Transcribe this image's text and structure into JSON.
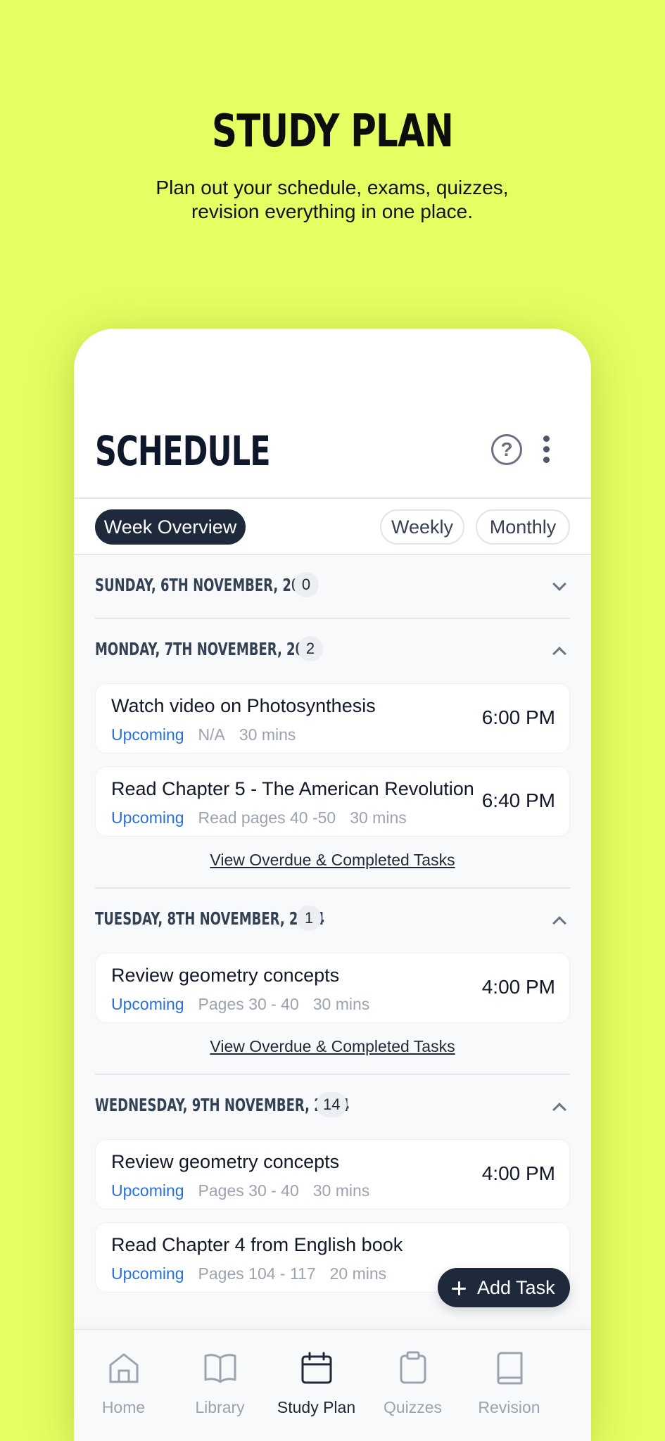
{
  "promo": {
    "title": "STUDY PLAN",
    "subtitle": "Plan out your schedule, exams, quizzes, revision everything in one place."
  },
  "header": {
    "title": "SCHEDULE",
    "help_icon": "question-circle-icon",
    "more_icon": "vertical-dots-icon"
  },
  "tabs": [
    {
      "label": "Week Overview",
      "active": true
    },
    {
      "label": "Weekly",
      "active": false
    },
    {
      "label": "Monthly",
      "active": false
    }
  ],
  "days": [
    {
      "title": "SUNDAY, 6TH NOVEMBER, 2024",
      "count": "0",
      "expanded": false,
      "tasks": []
    },
    {
      "title": "MONDAY, 7TH NOVEMBER, 2024",
      "count": "2",
      "expanded": true,
      "tasks": [
        {
          "title": "Watch video on Photosynthesis",
          "status": "Upcoming",
          "detail": "N/A",
          "duration": "30 mins",
          "time": "6:00 PM"
        },
        {
          "title": "Read Chapter 5 - The American Revolution",
          "status": "Upcoming",
          "detail": "Read pages 40 -50",
          "duration": "30 mins",
          "time": "6:40 PM"
        }
      ],
      "link": "View Overdue & Completed Tasks"
    },
    {
      "title": "TUESDAY, 8TH NOVEMBER, 2024",
      "count": "1",
      "expanded": true,
      "tasks": [
        {
          "title": "Review geometry concepts",
          "status": "Upcoming",
          "detail": "Pages 30 - 40",
          "duration": "30 mins",
          "time": "4:00 PM"
        }
      ],
      "link": "View Overdue & Completed Tasks"
    },
    {
      "title": "WEDNESDAY, 9TH NOVEMBER, 2024",
      "count": "14",
      "expanded": true,
      "tasks": [
        {
          "title": "Review geometry concepts",
          "status": "Upcoming",
          "detail": "Pages 30 - 40",
          "duration": "30 mins",
          "time": "4:00 PM"
        },
        {
          "title": "Read Chapter 4 from English book",
          "status": "Upcoming",
          "detail": "Pages 104 - 117",
          "duration": "20 mins",
          "time": ""
        }
      ]
    }
  ],
  "fab": {
    "label": "Add Task",
    "icon": "plus-icon"
  },
  "nav": [
    {
      "label": "Home",
      "icon": "home-icon",
      "active": false
    },
    {
      "label": "Library",
      "icon": "book-open-icon",
      "active": false
    },
    {
      "label": "Study Plan",
      "icon": "calendar-icon",
      "active": true
    },
    {
      "label": "Quizzes",
      "icon": "clipboard-icon",
      "active": false
    },
    {
      "label": "Revision",
      "icon": "book-icon",
      "active": false
    }
  ],
  "colors": {
    "background": "#e5fe61",
    "primary_dark": "#1e293b",
    "status_blue": "#2b6fd6"
  }
}
